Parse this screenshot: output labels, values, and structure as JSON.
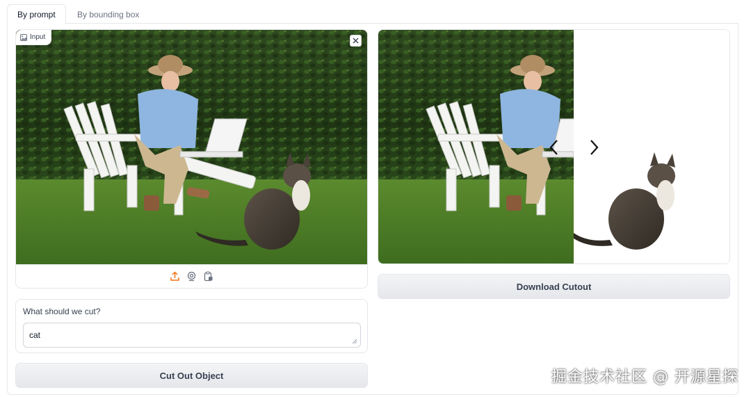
{
  "tabs": [
    {
      "label": "By prompt",
      "active": true
    },
    {
      "label": "By bounding box",
      "active": false
    }
  ],
  "input_panel": {
    "badge_label": "Input",
    "close_icon": "close-icon",
    "toolbar_icons": [
      "upload-icon",
      "webcam-icon",
      "clipboard-icon"
    ]
  },
  "prompt": {
    "label": "What should we cut?",
    "value": "cat"
  },
  "buttons": {
    "cut": "Cut Out Object",
    "download": "Download Cutout"
  },
  "watermark": "掘金技术社区 @ 开源星探",
  "colors": {
    "accent": "#f97316",
    "button_bg": "#f3f4f6",
    "border": "#e5e7eb"
  }
}
